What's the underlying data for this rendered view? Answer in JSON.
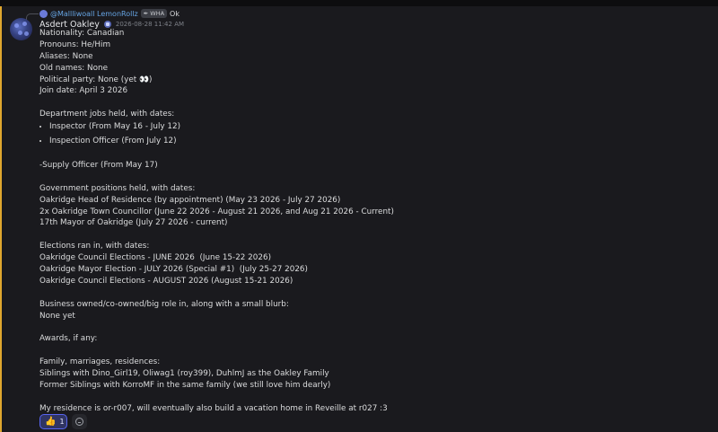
{
  "reply": {
    "author": "@Mallliwoall LemonRollz",
    "tag": "✒ WHA",
    "text": "Ok"
  },
  "message": {
    "author": "Asdert Oakley",
    "role_icon": "role-badge-icon",
    "timestamp": "2026-08-28 11:42 AM",
    "lines_top": [
      "Nationality: Canadian",
      "Pronouns: He/Him",
      "Aliases: None",
      "Old names: None",
      "Political party: None (yet 👀)",
      "Join date: April 3 2026",
      "",
      "Department jobs held, with dates:"
    ],
    "bullets": [
      "Inspector (From May 16 - July 12)",
      "Inspection Officer (From July 12)"
    ],
    "lines_bottom": [
      "",
      "-Supply Officer (From May 17)",
      "",
      "Government positions held, with dates:",
      "Oakridge Head of Residence (by appointment) (May 23 2026 - July 27 2026)",
      "2x Oakridge Town Councillor (June 22 2026 - August 21 2026, and Aug 21 2026 - Current)",
      "17th Mayor of Oakridge (July 27 2026 - current)",
      "",
      "Elections ran in, with dates:",
      "Oakridge Council Elections - JUNE 2026  (June 15-22 2026)",
      "Oakridge Mayor Election - JULY 2026 (Special #1)  (July 25-27 2026)",
      "Oakridge Council Elections - AUGUST 2026 (August 15-21 2026)",
      "",
      "Business owned/co-owned/big role in, along with a small blurb:",
      "None yet",
      "",
      "Awards, if any:",
      "",
      "Family, marriages, residences:",
      "Siblings with Dino_Girl19, Oliwag1 (roy399), DuhlmJ as the Oakley Family",
      "Former Siblings with KorroMF in the same family (we still love him dearly)",
      "",
      "My residence is or-r007, will eventually also build a vacation home in Reveille at r027 :3"
    ]
  },
  "reactions": [
    {
      "emoji": "👍",
      "count": "1"
    }
  ],
  "colors": {
    "background": "#1a1a1e",
    "mention_bar": "#e0a72f",
    "reply_author": "#66a4e3",
    "reaction_active": "#5865f2"
  }
}
